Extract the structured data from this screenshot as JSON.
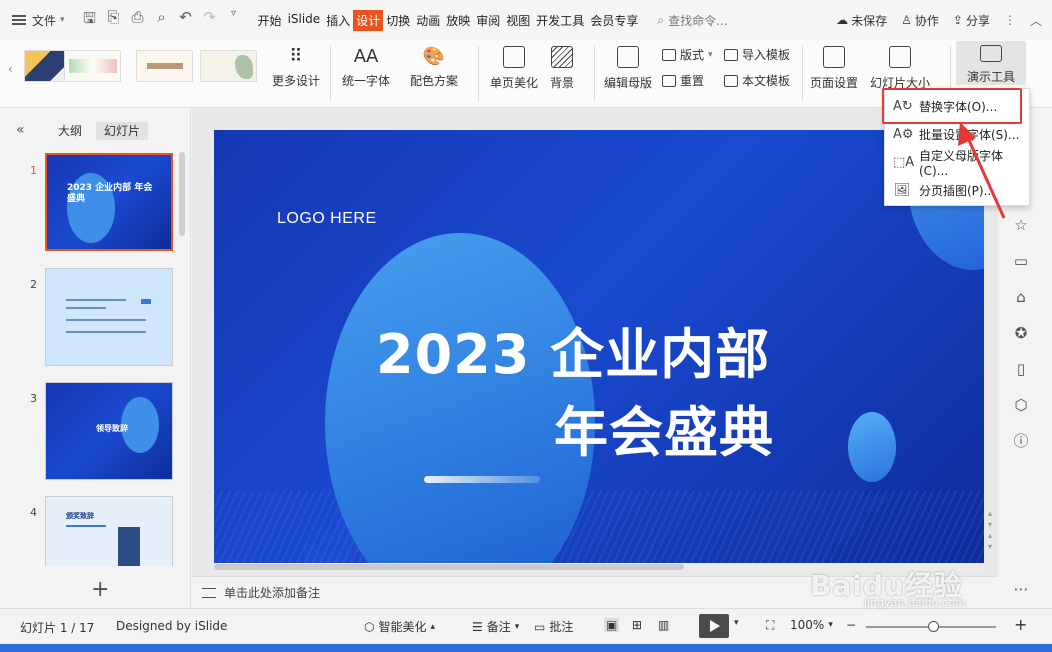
{
  "topbar": {
    "menu_label": "文件",
    "tabs": [
      "开始",
      "iSlide",
      "插入",
      "设计",
      "切换",
      "动画",
      "放映",
      "审阅",
      "视图",
      "开发工具",
      "会员专享"
    ],
    "active_tab": "设计",
    "search_placeholder": "查找命令...",
    "unsaved": "未保存",
    "collab": "协作",
    "share": "分享"
  },
  "ribbon": {
    "more_design": "更多设计",
    "unify_font": "统一字体",
    "color_scheme": "配色方案",
    "single_page": "单页美化",
    "background": "背景",
    "edit_master": "编辑母版",
    "layout": "版式",
    "reset": "重置",
    "import_template": "导入模板",
    "text_template": "本文模板",
    "page_setup": "页面设置",
    "slide_size": "幻灯片大小",
    "present_tools": "演示工具"
  },
  "left_panel": {
    "outline_tab": "大纲",
    "slides_tab": "幻灯片",
    "slides": [
      {
        "num": "1",
        "text": "2023 企业内部 年会盛典"
      },
      {
        "num": "2",
        "text": ""
      },
      {
        "num": "3",
        "text": "领导致辞"
      },
      {
        "num": "4",
        "text": "颁奖致辞"
      }
    ]
  },
  "slide": {
    "logo": "LOGO HERE",
    "title_line1": "2023 企业内部",
    "title_line2": "年会盛典"
  },
  "notes_placeholder": "单击此处添加备注",
  "dropdown": {
    "items": [
      {
        "label": "替换字体(O)..."
      },
      {
        "label": "批量设置字体(S)..."
      },
      {
        "label": "自定义母版字体(C)..."
      },
      {
        "label": "分页插图(P)..."
      }
    ]
  },
  "statusbar": {
    "slide_counter": "幻灯片 1 / 17",
    "designer": "Designed by iSlide",
    "smart_beautify": "智能美化",
    "notes": "备注",
    "comments": "批注",
    "zoom": "100%"
  },
  "watermark": {
    "text": "Baidu经验",
    "sub": "jingyan.baidu.com"
  },
  "colors": {
    "accent": "#e8541c",
    "slide_blue": "#1a4ad0",
    "highlight_red": "#e53935"
  }
}
